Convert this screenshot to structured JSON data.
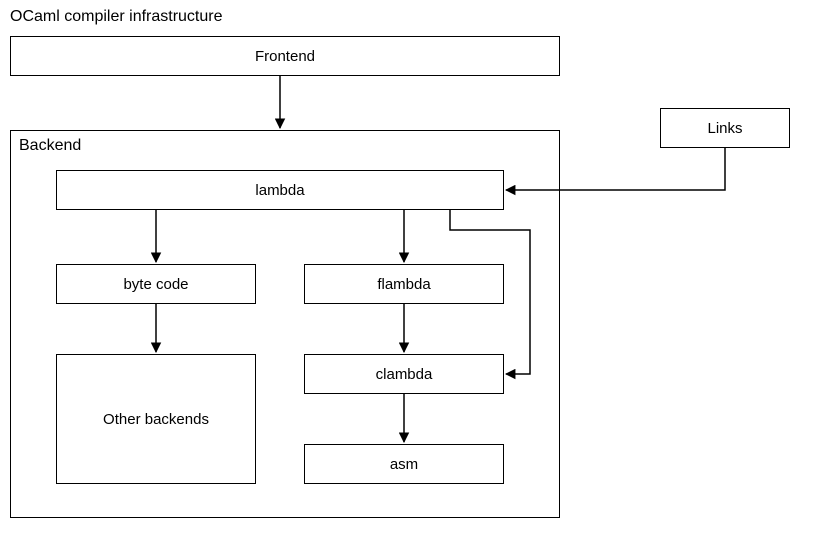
{
  "title": "OCaml compiler infrastructure",
  "backend_label": "Backend",
  "nodes": {
    "frontend": "Frontend",
    "links": "Links",
    "lambda": "lambda",
    "bytecode": "byte code",
    "flambda": "flambda",
    "clambda": "clambda",
    "asm": "asm",
    "other_backends": "Other backends"
  },
  "edges": [
    {
      "from": "frontend",
      "to": "lambda"
    },
    {
      "from": "links",
      "to": "lambda"
    },
    {
      "from": "lambda",
      "to": "bytecode"
    },
    {
      "from": "lambda",
      "to": "flambda"
    },
    {
      "from": "lambda",
      "to": "clambda"
    },
    {
      "from": "flambda",
      "to": "clambda"
    },
    {
      "from": "clambda",
      "to": "asm"
    },
    {
      "from": "bytecode",
      "to": "other_backends"
    }
  ],
  "chart_data": {
    "type": "diagram",
    "title": "OCaml compiler infrastructure",
    "clusters": [
      {
        "name": "Backend",
        "nodes": [
          "lambda",
          "byte code",
          "flambda",
          "clambda",
          "asm",
          "Other backends"
        ]
      }
    ],
    "nodes": [
      "Frontend",
      "Links",
      "lambda",
      "byte code",
      "flambda",
      "clambda",
      "asm",
      "Other backends"
    ],
    "edges": [
      [
        "Frontend",
        "lambda"
      ],
      [
        "Links",
        "lambda"
      ],
      [
        "lambda",
        "byte code"
      ],
      [
        "lambda",
        "flambda"
      ],
      [
        "lambda",
        "clambda"
      ],
      [
        "flambda",
        "clambda"
      ],
      [
        "clambda",
        "asm"
      ],
      [
        "byte code",
        "Other backends"
      ]
    ]
  }
}
